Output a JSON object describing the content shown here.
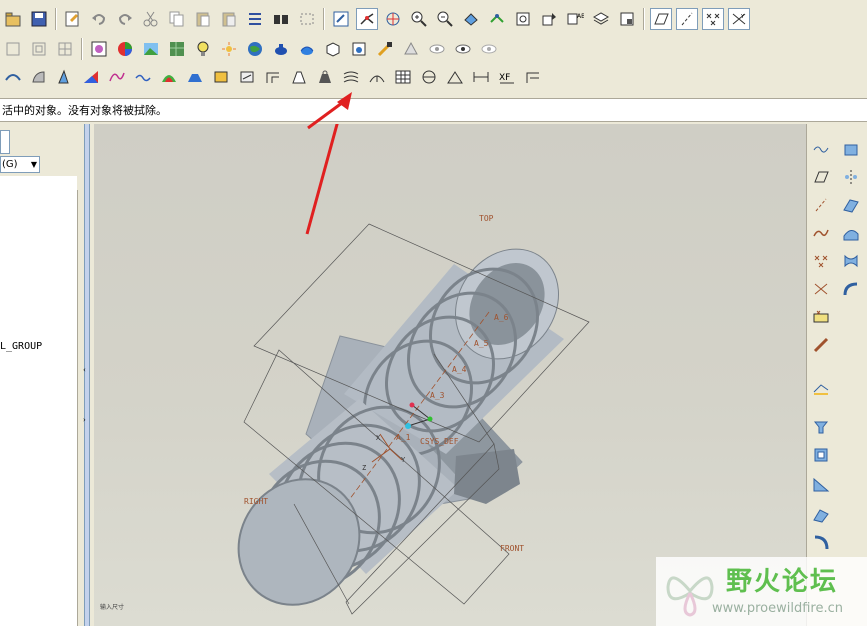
{
  "message_bar": {
    "text": "活中的对象。没有对象将被拭除。"
  },
  "model_tree": {
    "show_label": "(G)",
    "item_label": "L_GROUP"
  },
  "graphics": {
    "datum_planes": {
      "top": "TOP",
      "right": "RIGHT",
      "front": "FRONT"
    },
    "axes": [
      "A_6",
      "A_5",
      "A_4",
      "A_3",
      "A_1"
    ],
    "csys": "CSYS_DEF",
    "csys_axes": {
      "x": "X",
      "y": "Y",
      "z": "Z"
    },
    "status_text": "输入尺寸"
  },
  "watermark": {
    "title": "野火论坛",
    "url": "www.proewildfire.cn"
  },
  "colors": {
    "model_gray": "#a9b1ba",
    "arrow_red": "#e02020",
    "datum_brown": "#a0522d",
    "watermark_green": "#5fbf4f"
  }
}
